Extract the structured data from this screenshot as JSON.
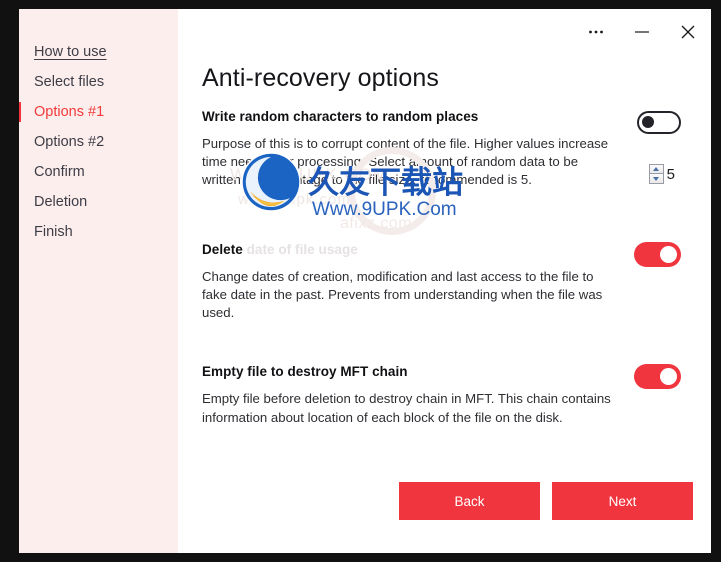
{
  "window": {
    "titlebar": {
      "more_label": "•••",
      "minimize_label": "—",
      "close_label": "✕"
    }
  },
  "sidebar": {
    "items": [
      {
        "label": "How to use",
        "active": false,
        "underlined": true
      },
      {
        "label": "Select files",
        "active": false,
        "underlined": false
      },
      {
        "label": "Options #1",
        "active": true,
        "underlined": false
      },
      {
        "label": "Options #2",
        "active": false,
        "underlined": false
      },
      {
        "label": "Confirm",
        "active": false,
        "underlined": false
      },
      {
        "label": "Deletion",
        "active": false,
        "underlined": false
      },
      {
        "label": "Finish",
        "active": false,
        "underlined": false
      }
    ]
  },
  "main": {
    "page_title": "Anti-recovery options",
    "options": [
      {
        "heading": "Write random characters to random places",
        "heading_faded": "",
        "description": "Purpose of this is to corrupt content of the file. Higher values increase time needed for processing. Select amount of random data to be written, in percentage to the file size, recommended is 5.",
        "toggle_state": "off",
        "spinner_value": "5"
      },
      {
        "heading": "Delete",
        "heading_faded": " date of file usage",
        "description": "Change dates of creation, modification and last access to the file to fake date in the past. Prevents from understanding when the file was used.",
        "toggle_state": "on",
        "spinner_value": ""
      },
      {
        "heading": "Empty file to destroy MFT chain",
        "heading_faded": "",
        "description": "Empty file before deletion to destroy chain in MFT. This chain contains information about location of each block of the file on the disk.",
        "toggle_state": "on",
        "spinner_value": ""
      }
    ],
    "footer": {
      "back_label": "Back",
      "next_label": "Next"
    }
  },
  "watermark": {
    "chinese_text": "久友下载站",
    "url_text": "Www.9UPK.Com",
    "ghost_line1": "WWW.9UPK.COM",
    "ghost_line2": "www.9upk.com",
    "ghost_line3": "afixz.com"
  },
  "colors": {
    "accent_red": "#f1353f",
    "sidebar_bg": "#fdeeee",
    "active_text": "#f23a3a",
    "watermark_blue": "#1b55b5"
  }
}
